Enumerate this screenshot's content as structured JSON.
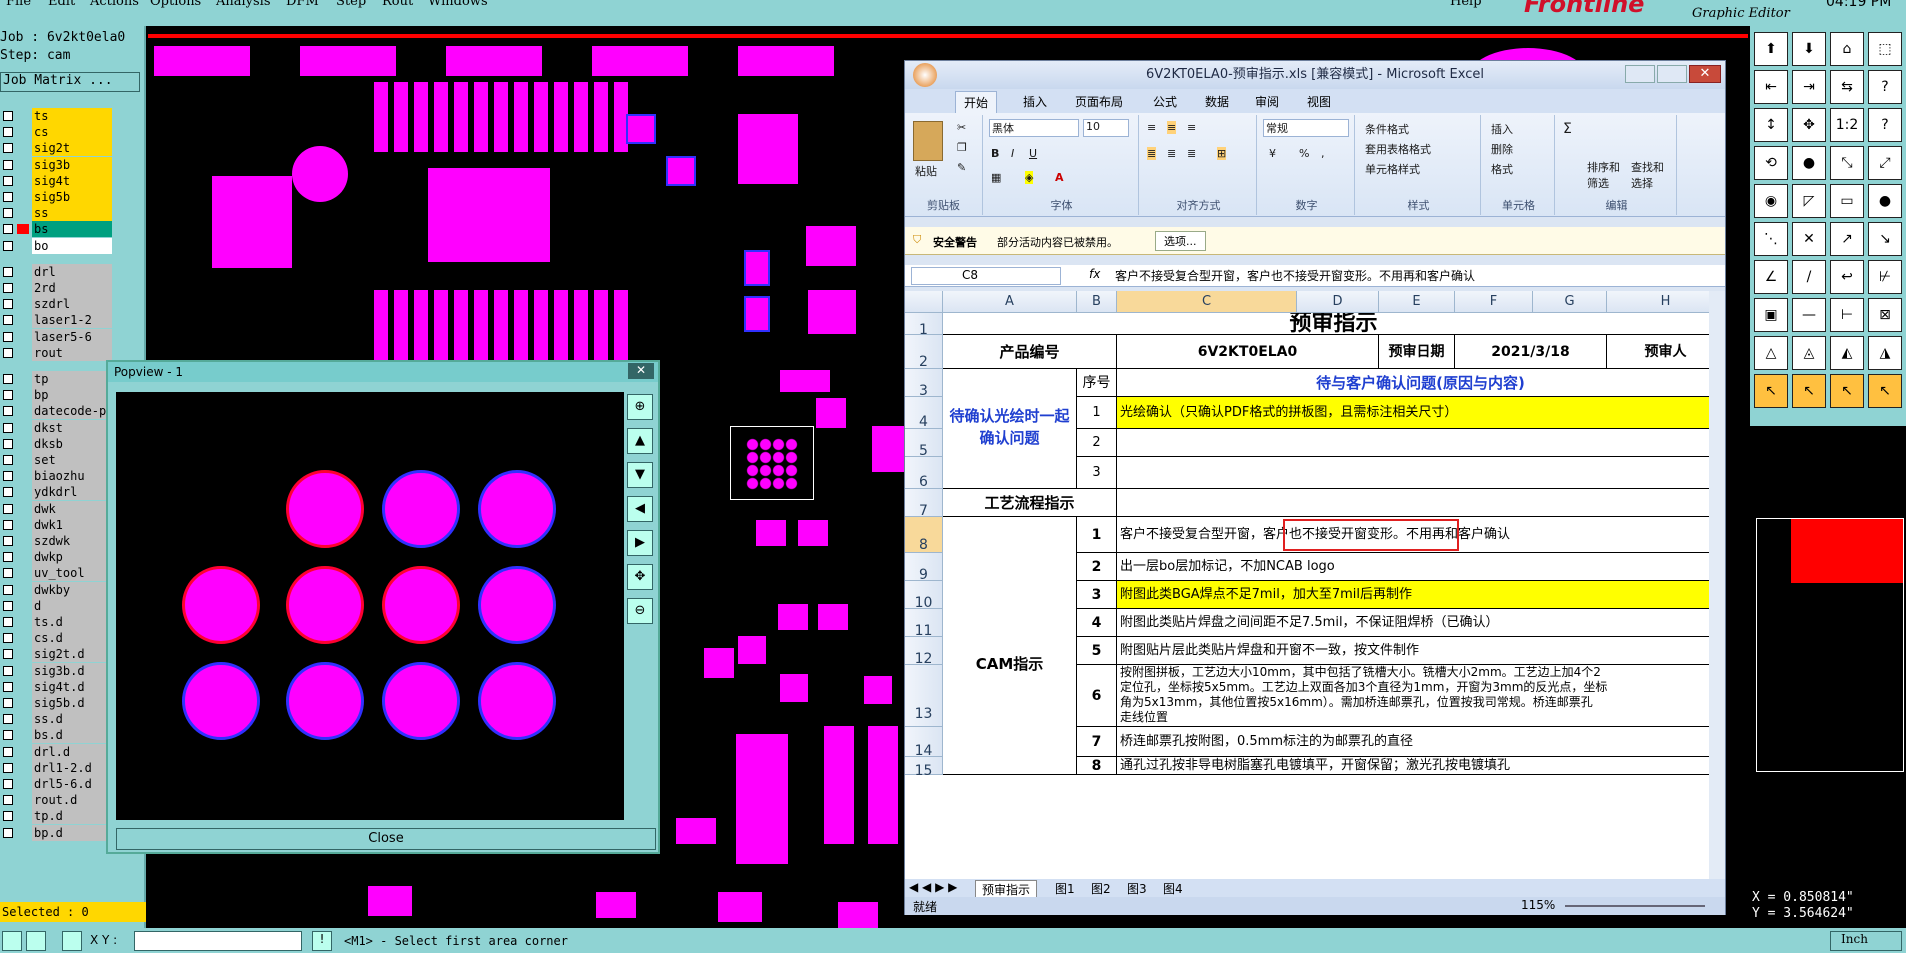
{
  "menubar": {
    "items": [
      "File",
      "Edit",
      "Actions",
      "Options",
      "Analysis",
      "DFM",
      "Step",
      "Rout",
      "Windows"
    ],
    "help": "Help",
    "brand": "Frontline",
    "subtitle": "Graphic Editor",
    "time": "04:19 PM"
  },
  "job": {
    "job_label": "Job : 6v2kt0ela0",
    "step_label": "Step: cam",
    "matrix_button": "Job Matrix ..."
  },
  "layers": [
    {
      "name": "ts",
      "color": "#ffd700"
    },
    {
      "name": "cs",
      "color": "#ffd700"
    },
    {
      "name": "sig2t",
      "color": "#ffd700"
    },
    {
      "name": "sig3b",
      "color": "#ffd700"
    },
    {
      "name": "sig4t",
      "color": "#ffd700"
    },
    {
      "name": "sig5b",
      "color": "#ffd700"
    },
    {
      "name": "ss",
      "color": "#ffd700"
    },
    {
      "name": "bs",
      "color": "#00a080",
      "active": true
    },
    {
      "name": "bo",
      "color": "#ffffff"
    },
    {
      "name": "drl",
      "color": "#c0c0c0"
    },
    {
      "name": "2rd",
      "color": "#c0c0c0"
    },
    {
      "name": "szdrl",
      "color": "#c0c0c0"
    },
    {
      "name": "laser1-2",
      "color": "#c0c0c0"
    },
    {
      "name": "laser5-6",
      "color": "#c0c0c0"
    },
    {
      "name": "rout",
      "color": "#c0c0c0"
    },
    {
      "name": "tp",
      "color": "#c0c0c0"
    },
    {
      "name": "bp",
      "color": "#c0c0c0"
    },
    {
      "name": "datecode-p",
      "color": "#c0c0c0"
    },
    {
      "name": "dkst",
      "color": "#c0c0c0"
    },
    {
      "name": "dksb",
      "color": "#c0c0c0"
    },
    {
      "name": "set",
      "color": "#c0c0c0"
    },
    {
      "name": "biaozhu",
      "color": "#c0c0c0"
    },
    {
      "name": "ydkdrl",
      "color": "#c0c0c0"
    },
    {
      "name": "dwk",
      "color": "#c0c0c0"
    },
    {
      "name": "dwk1",
      "color": "#c0c0c0"
    },
    {
      "name": "szdwk",
      "color": "#c0c0c0"
    },
    {
      "name": "dwkp",
      "color": "#c0c0c0"
    },
    {
      "name": "uv_tool",
      "color": "#c0c0c0"
    },
    {
      "name": "dwkby",
      "color": "#c0c0c0"
    },
    {
      "name": "d",
      "color": "#c0c0c0"
    },
    {
      "name": "ts.d",
      "color": "#c0c0c0"
    },
    {
      "name": "cs.d",
      "color": "#c0c0c0"
    },
    {
      "name": "sig2t.d",
      "color": "#c0c0c0"
    },
    {
      "name": "sig3b.d",
      "color": "#c0c0c0"
    },
    {
      "name": "sig4t.d",
      "color": "#c0c0c0"
    },
    {
      "name": "sig5b.d",
      "color": "#c0c0c0"
    },
    {
      "name": "ss.d",
      "color": "#c0c0c0"
    },
    {
      "name": "bs.d",
      "color": "#c0c0c0"
    },
    {
      "name": "drl.d",
      "color": "#c0c0c0"
    },
    {
      "name": "drl1-2.d",
      "color": "#c0c0c0"
    },
    {
      "name": "drl5-6.d",
      "color": "#c0c0c0"
    },
    {
      "name": "rout.d",
      "color": "#c0c0c0"
    },
    {
      "name": "tp.d",
      "color": "#c0c0c0"
    },
    {
      "name": "bp.d",
      "color": "#c0c0c0"
    }
  ],
  "selected": "Selected : 0",
  "popview": {
    "title": "Popview - 1",
    "close": "Close"
  },
  "excel": {
    "title": "6V2KT0ELA0-预审指示.xls [兼容模式] - Microsoft Excel",
    "tabs": [
      "开始",
      "插入",
      "页面布局",
      "公式",
      "数据",
      "审阅",
      "视图"
    ],
    "groups": {
      "clipboard": "剪贴板",
      "font": "字体",
      "align": "对齐方式",
      "number": "数字",
      "style": "样式",
      "cells": "单元格",
      "edit": "编辑"
    },
    "paste": "粘贴",
    "font_name": "黑体",
    "font_size": "10",
    "num_format": "常规",
    "style_items": [
      "条件格式",
      "套用表格格式",
      "单元格样式"
    ],
    "cell_items": [
      "插入",
      "删除",
      "格式"
    ],
    "edit_items": [
      "排序和筛选",
      "查找和选择"
    ],
    "security_label": "安全警告",
    "security_text": "部分活动内容已被禁用。",
    "security_button": "选项...",
    "name_box": "C8",
    "fx": "fx",
    "formula": "客户不接受复合型开窗，客户也不接受开窗变形。不用再和客户确认",
    "col_headers": [
      "A",
      "B",
      "C",
      "D",
      "E",
      "F",
      "G",
      "H"
    ],
    "row_headers": [
      "1",
      "2",
      "3",
      "4",
      "5",
      "6",
      "7",
      "8",
      "9",
      "10",
      "11",
      "12",
      "13",
      "14",
      "15"
    ],
    "sheet_title": "预审指示",
    "r2": {
      "product": "产品编号",
      "code": "6V2KT0ELA0",
      "date_label": "预审日期",
      "date": "2021/3/18",
      "reviewer": "预审人"
    },
    "r3": {
      "seq": "序号",
      "header": "待与客户确认问题(原因与内容)"
    },
    "pending": "待确认光绘时一起确认问题",
    "pending_rows": [
      {
        "n": "1",
        "text": "光绘确认（只确认PDF格式的拼板图，且需标注相关尺寸）"
      },
      {
        "n": "2",
        "text": ""
      },
      {
        "n": "3",
        "text": ""
      }
    ],
    "process": "工艺流程指示",
    "cam": "CAM指示",
    "cam_rows": [
      {
        "n": "1",
        "text": "客户不接受复合型开窗，客户也不接受开窗变形。不用再和客户确认"
      },
      {
        "n": "2",
        "text": "出一层bo层加标记，不加NCAB logo"
      },
      {
        "n": "3",
        "text": "附图此类BGA焊点不足7mil，加大至7mil后再制作"
      },
      {
        "n": "4",
        "text": "附图此类贴片焊盘之间间距不足7.5mil，不保证阻焊桥（已确认）"
      },
      {
        "n": "5",
        "text": "附图贴片层此类贴片焊盘和开窗不一致，按文件制作"
      },
      {
        "n": "6",
        "lines": [
          "按附图拼板，工艺边大小10mm，其中包括了铣槽大小。铣槽大小2mm。工艺边上加4个2",
          "定位孔，坐标按5x5mm。工艺边上双面各加3个直径为1mm，开窗为3mm的反光点，坐标",
          "角为5x13mm，其他位置按5x16mm）。需加桥连邮票孔，位置按我司常规。桥连邮票孔",
          "走线位置"
        ]
      },
      {
        "n": "7",
        "text": "桥连邮票孔按附图，0.5mm标注的为邮票孔的直径"
      },
      {
        "n": "8",
        "text": "通孔过孔按非导电树脂塞孔电镀填平，开窗保留；激光孔按电镀填孔"
      }
    ],
    "sheet_tabs": [
      "预审指示",
      "图1",
      "图2",
      "图3",
      "图4"
    ],
    "status": "就绪",
    "zoom": "115%"
  },
  "coords": {
    "x": "X = 0.850814\"",
    "y": "Y = 3.564624\""
  },
  "bottom": {
    "xy_label": "X Y :",
    "hint": "<M1> - Select first area corner",
    "units": "Inch"
  },
  "colors": {
    "cyan": "#8fd3d3",
    "magenta": "#ff00ff",
    "blue": "#3030ff",
    "yellow": "#ffff00",
    "excel_header": "#dbe5f3"
  }
}
